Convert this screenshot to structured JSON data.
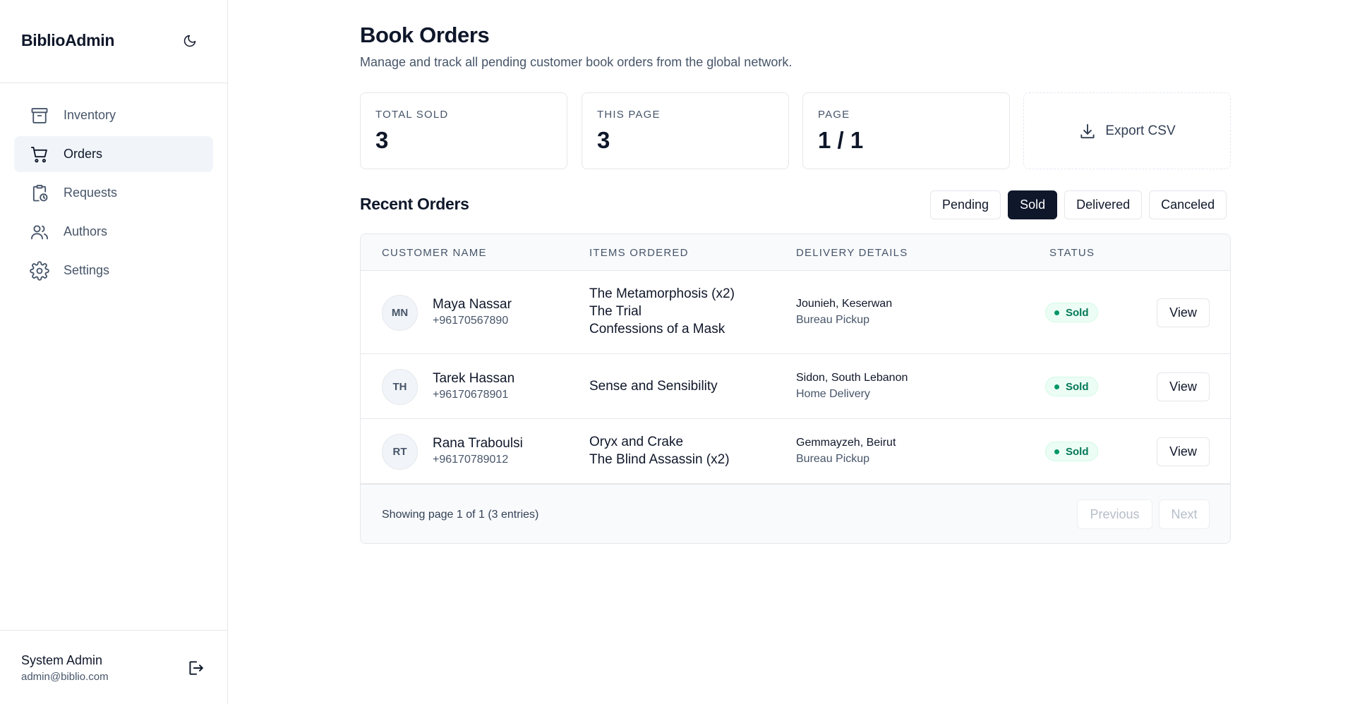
{
  "app": {
    "brand": "BiblioAdmin"
  },
  "sidebar": {
    "items": [
      {
        "label": "Inventory",
        "icon": "archive-box-icon",
        "active": false
      },
      {
        "label": "Orders",
        "icon": "shopping-cart-icon",
        "active": true
      },
      {
        "label": "Requests",
        "icon": "clipboard-clock-icon",
        "active": false
      },
      {
        "label": "Authors",
        "icon": "users-icon",
        "active": false
      },
      {
        "label": "Settings",
        "icon": "gear-icon",
        "active": false
      }
    ],
    "user": {
      "name": "System Admin",
      "email": "admin@biblio.com"
    }
  },
  "header": {
    "title": "Book Orders",
    "subtitle": "Manage and track all pending customer book orders from the global network."
  },
  "stats": [
    {
      "label": "TOTAL SOLD",
      "value": "3"
    },
    {
      "label": "THIS PAGE",
      "value": "3"
    },
    {
      "label": "PAGE",
      "value": "1 / 1"
    }
  ],
  "export": {
    "label": "Export CSV"
  },
  "orders": {
    "title": "Recent Orders",
    "filters": [
      "Pending",
      "Sold",
      "Delivered",
      "Canceled"
    ],
    "active_filter": "Sold",
    "columns": [
      "CUSTOMER NAME",
      "ITEMS ORDERED",
      "DELIVERY DETAILS",
      "STATUS"
    ],
    "rows": [
      {
        "initials": "MN",
        "name": "Maya Nassar",
        "phone": "+96170567890",
        "items": [
          "The Metamorphosis (x2)",
          "The Trial",
          "Confessions of a Mask"
        ],
        "place": "Jounieh, Keserwan",
        "method": "Bureau Pickup",
        "status": "Sold",
        "action": "View"
      },
      {
        "initials": "TH",
        "name": "Tarek Hassan",
        "phone": "+96170678901",
        "items": [
          "Sense and Sensibility"
        ],
        "place": "Sidon, South Lebanon",
        "method": "Home Delivery",
        "status": "Sold",
        "action": "View"
      },
      {
        "initials": "RT",
        "name": "Rana Traboulsi",
        "phone": "+96170789012",
        "items": [
          "Oryx and Crake",
          "The Blind Assassin (x2)"
        ],
        "place": "Gemmayzeh, Beirut",
        "method": "Bureau Pickup",
        "status": "Sold",
        "action": "View"
      }
    ],
    "footer": {
      "showing": "Showing page 1 of 1 (3 entries)",
      "previous": "Previous",
      "next": "Next"
    }
  },
  "colors": {
    "primary": "#0f172a",
    "muted": "#475569",
    "border": "#e5e7eb",
    "active_bg": "#f1f5f9",
    "success": "#059669",
    "success_bg": "#ecfdf5"
  }
}
